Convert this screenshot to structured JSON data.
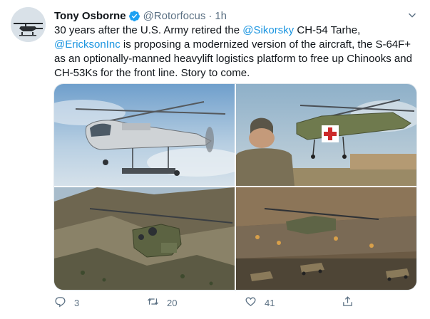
{
  "author": {
    "name": "Tony Osborne",
    "handle": "@Rotorfocus",
    "separator": "·",
    "time": "1h"
  },
  "tweet": {
    "part1": "30 years after the U.S. Army retired the ",
    "mention1": "@Sikorsky",
    "part2": " CH-54 Tarhe, ",
    "mention2": "@EricksonInc",
    "part3": " is proposing a modernized version of the aircraft, the S-64F+ as an optionally-manned heavylift logistics platform to free up Chinooks and CH-53Ks for the front line. Story to come."
  },
  "stats": {
    "replies": "3",
    "retweets": "20",
    "likes": "41"
  },
  "icons": {
    "verified": "verified-badge-icon",
    "more": "more-options-icon",
    "reply": "reply-icon",
    "retweet": "retweet-icon",
    "like": "heart-icon",
    "share": "share-icon"
  },
  "colors": {
    "link": "#1b95e0",
    "secondary_text": "#5b7083",
    "primary_text": "#0f1419",
    "border": "#e1e8ed"
  }
}
